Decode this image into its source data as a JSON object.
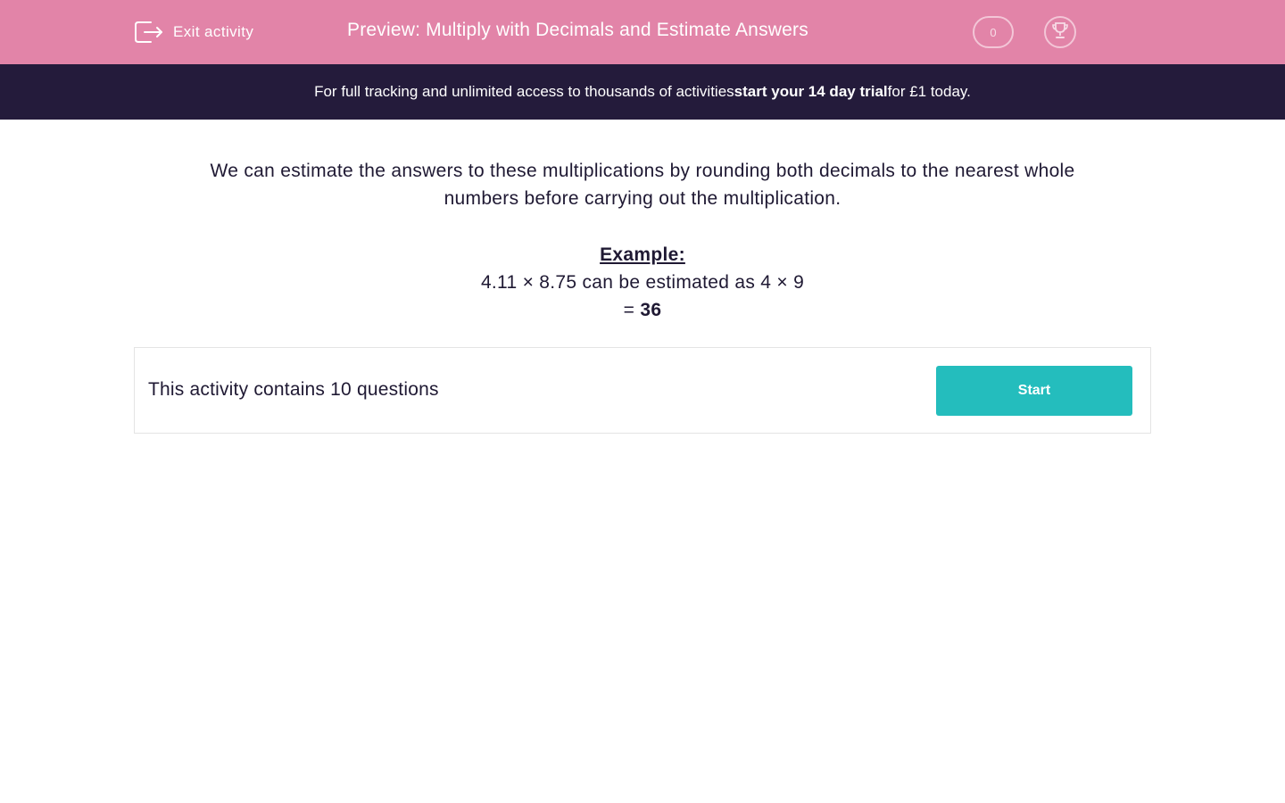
{
  "header": {
    "exit_label": "Exit activity",
    "title": "Preview: Multiply with Decimals and Estimate Answers",
    "score": "0",
    "trophy_icon": "trophy-icon",
    "exit_icon": "exit-icon"
  },
  "promo": {
    "prefix": "For full tracking and unlimited access to thousands of activities ",
    "link": "start your 14 day trial",
    "suffix": " for £1 today."
  },
  "intro": {
    "line1": "We can estimate the answers to these multiplications by rounding both decimals to the nearest whole",
    "line2": "numbers before carrying out the multiplication."
  },
  "example": {
    "heading": "Example:",
    "line": "4.11 × 8.75 can be estimated as 4 × 9",
    "result_prefix": "= ",
    "result_value": "36"
  },
  "activity": {
    "summary": "This activity contains 10 questions",
    "start_label": "Start"
  },
  "colors": {
    "header_bg": "#e284a8",
    "promo_bg": "#241b3b",
    "button_bg": "#24bdbd",
    "text": "#1f1933"
  }
}
